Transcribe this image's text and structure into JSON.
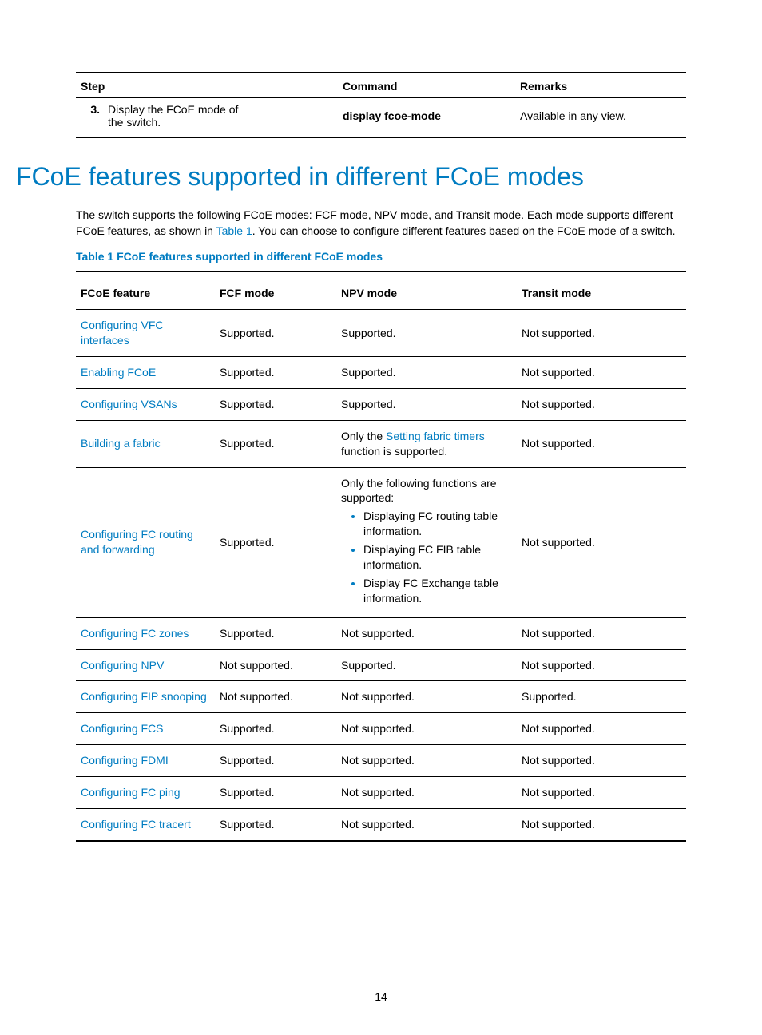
{
  "step_table": {
    "headers": {
      "step": "Step",
      "command": "Command",
      "remarks": "Remarks"
    },
    "row": {
      "num": "3.",
      "text": "Display the FCoE mode of the switch.",
      "command": "display fcoe-mode",
      "remarks": "Available in any view."
    }
  },
  "heading": "FCoE features supported in different FCoE modes",
  "intro": {
    "part1": "The switch supports the following FCoE modes: FCF mode, NPV mode, and Transit mode. Each mode supports different FCoE features, as shown in ",
    "link": "Table 1",
    "part2": ". You can choose to configure different features based on the FCoE mode of a switch."
  },
  "table_caption": "Table 1 FCoE features supported in different FCoE modes",
  "feat_headers": {
    "feature": "FCoE feature",
    "fcf": "FCF mode",
    "npv": "NPV mode",
    "transit": "Transit mode"
  },
  "rows": {
    "r0": {
      "feature": "Configuring VFC interfaces",
      "fcf": "Supported.",
      "npv": "Supported.",
      "transit": "Not supported."
    },
    "r1": {
      "feature": "Enabling FCoE",
      "fcf": "Supported.",
      "npv": "Supported.",
      "transit": "Not supported."
    },
    "r2": {
      "feature": "Configuring VSANs",
      "fcf": "Supported.",
      "npv": "Supported.",
      "transit": "Not supported."
    },
    "r3": {
      "feature": "Building a fabric",
      "fcf": "Supported.",
      "npv_pre": "Only the ",
      "npv_link": "Setting fabric timers",
      "npv_post": " function is supported.",
      "transit": "Not supported."
    },
    "r4": {
      "feature": "Configuring FC routing and forwarding",
      "fcf": "Supported.",
      "npv_intro": "Only the following functions are supported:",
      "npv_b1": "Displaying FC routing table information.",
      "npv_b2": "Displaying FC FIB table information.",
      "npv_b3": "Display FC Exchange table information.",
      "transit": "Not supported."
    },
    "r5": {
      "feature": "Configuring FC zones",
      "fcf": "Supported.",
      "npv": "Not supported.",
      "transit": "Not supported."
    },
    "r6": {
      "feature": "Configuring NPV",
      "fcf": "Not supported.",
      "npv": "Supported.",
      "transit": "Not supported."
    },
    "r7": {
      "feature": "Configuring FIP snooping",
      "fcf": "Not supported.",
      "npv": "Not supported.",
      "transit": "Supported."
    },
    "r8": {
      "feature": "Configuring FCS",
      "fcf": "Supported.",
      "npv": "Not supported.",
      "transit": "Not supported."
    },
    "r9": {
      "feature": "Configuring FDMI",
      "fcf": "Supported.",
      "npv": "Not supported.",
      "transit": "Not supported."
    },
    "r10": {
      "feature": "Configuring FC ping",
      "fcf": "Supported.",
      "npv": "Not supported.",
      "transit": "Not supported."
    },
    "r11": {
      "feature": "Configuring FC tracert",
      "fcf": "Supported.",
      "npv": "Not supported.",
      "transit": "Not supported."
    }
  },
  "page_number": "14"
}
